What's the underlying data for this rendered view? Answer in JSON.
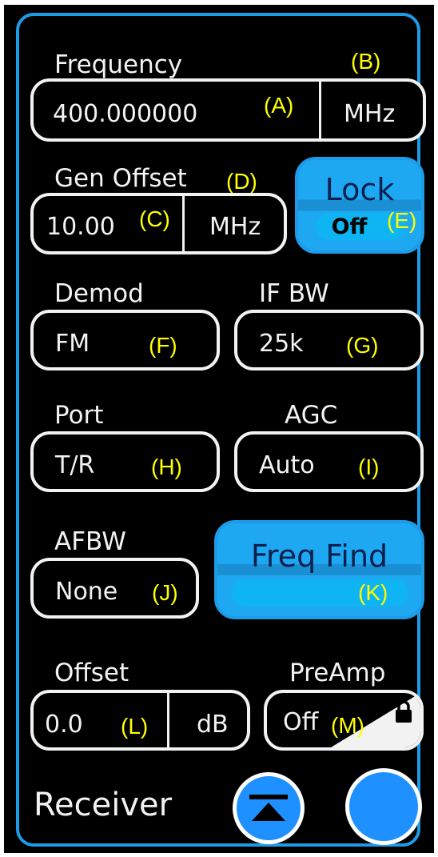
{
  "panel": {
    "title": "Receiver"
  },
  "frequency": {
    "label": "Frequency",
    "value": "400.000000",
    "unit": "MHz",
    "ann_value": "(A)",
    "ann_unit": "(B)"
  },
  "gen_offset": {
    "label": "Gen Offset",
    "value": "10.00",
    "unit": "MHz",
    "ann_value": "(C)",
    "ann_unit": "(D)"
  },
  "lock": {
    "label": "Lock",
    "state": "Off",
    "ann": "(E)"
  },
  "demod": {
    "label": "Demod",
    "value": "FM",
    "ann": "(F)"
  },
  "if_bw": {
    "label": "IF BW",
    "value": "25k",
    "ann": "(G)"
  },
  "port": {
    "label": "Port",
    "value": "T/R",
    "ann": "(H)"
  },
  "agc": {
    "label": "AGC",
    "value": "Auto",
    "ann": "(I)"
  },
  "afbw": {
    "label": "AFBW",
    "value": "None",
    "ann": "(J)"
  },
  "freq_find": {
    "label": "Freq Find",
    "ann": "(K)"
  },
  "offset": {
    "label": "Offset",
    "value": "0.0",
    "unit": "dB",
    "ann": "(L)"
  },
  "preamp": {
    "label": "PreAmp",
    "value": "Off",
    "ann": "(M)"
  },
  "icons": {
    "collapse": "collapse-up-icon",
    "lock": "padlock-icon"
  },
  "colors": {
    "accent": "#1e9be8",
    "button_fill": "#1ea8f2",
    "annotation": "#ffff00",
    "text": "#f2f2f2"
  }
}
